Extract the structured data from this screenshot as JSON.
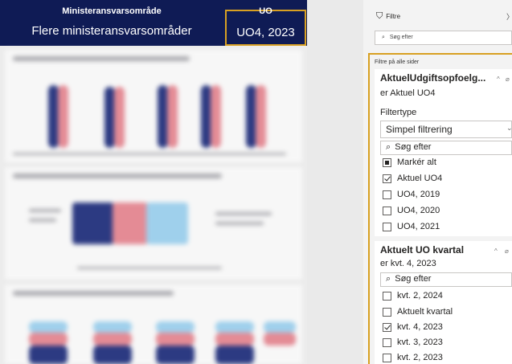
{
  "header": {
    "left_label": "Ministeransvarsområde",
    "left_value": "Flere ministeransvarsområder",
    "right_label": "UO",
    "right_value": "UO4, 2023"
  },
  "filter_pane": {
    "title": "Filtre",
    "close_glyph": "〉",
    "search_placeholder": "Søg efter",
    "all_pages_label": "Filtre på alle sider",
    "cards": [
      {
        "title": "AktuelUdgiftsopfoelg...",
        "subtitle": "er Aktuel UO4",
        "filter_type_label": "Filtertype",
        "filter_type_value": "Simpel filtrering",
        "search_placeholder": "Søg efter",
        "options": [
          {
            "label": "Markér alt",
            "state": "partial"
          },
          {
            "label": "Aktuel UO4",
            "state": "checked"
          },
          {
            "label": "UO4, 2019",
            "state": "unchecked"
          },
          {
            "label": "UO4, 2020",
            "state": "unchecked"
          },
          {
            "label": "UO4, 2021",
            "state": "unchecked"
          }
        ]
      },
      {
        "title": "Aktuelt UO kvartal",
        "subtitle": "er kvt. 4, 2023",
        "search_placeholder": "Søg efter",
        "options": [
          {
            "label": "kvt. 2, 2024",
            "state": "unchecked"
          },
          {
            "label": "Aktuelt kvartal",
            "state": "unchecked"
          },
          {
            "label": "kvt. 4, 2023",
            "state": "checked"
          },
          {
            "label": "kvt. 3, 2023",
            "state": "unchecked"
          },
          {
            "label": "kvt. 2, 2023",
            "state": "unchecked"
          }
        ]
      }
    ]
  },
  "icons": {
    "filter": "funnel-icon",
    "search": "search-icon",
    "collapse": "chevron-up-icon",
    "erase": "eraser-icon",
    "dropdown": "chevron-down-icon"
  },
  "colors": {
    "header_bg": "#0f1b55",
    "highlight": "#d8a022",
    "series_navy": "#2c3a82",
    "series_red": "#e48b95",
    "series_lightblue": "#9fd0ec"
  }
}
